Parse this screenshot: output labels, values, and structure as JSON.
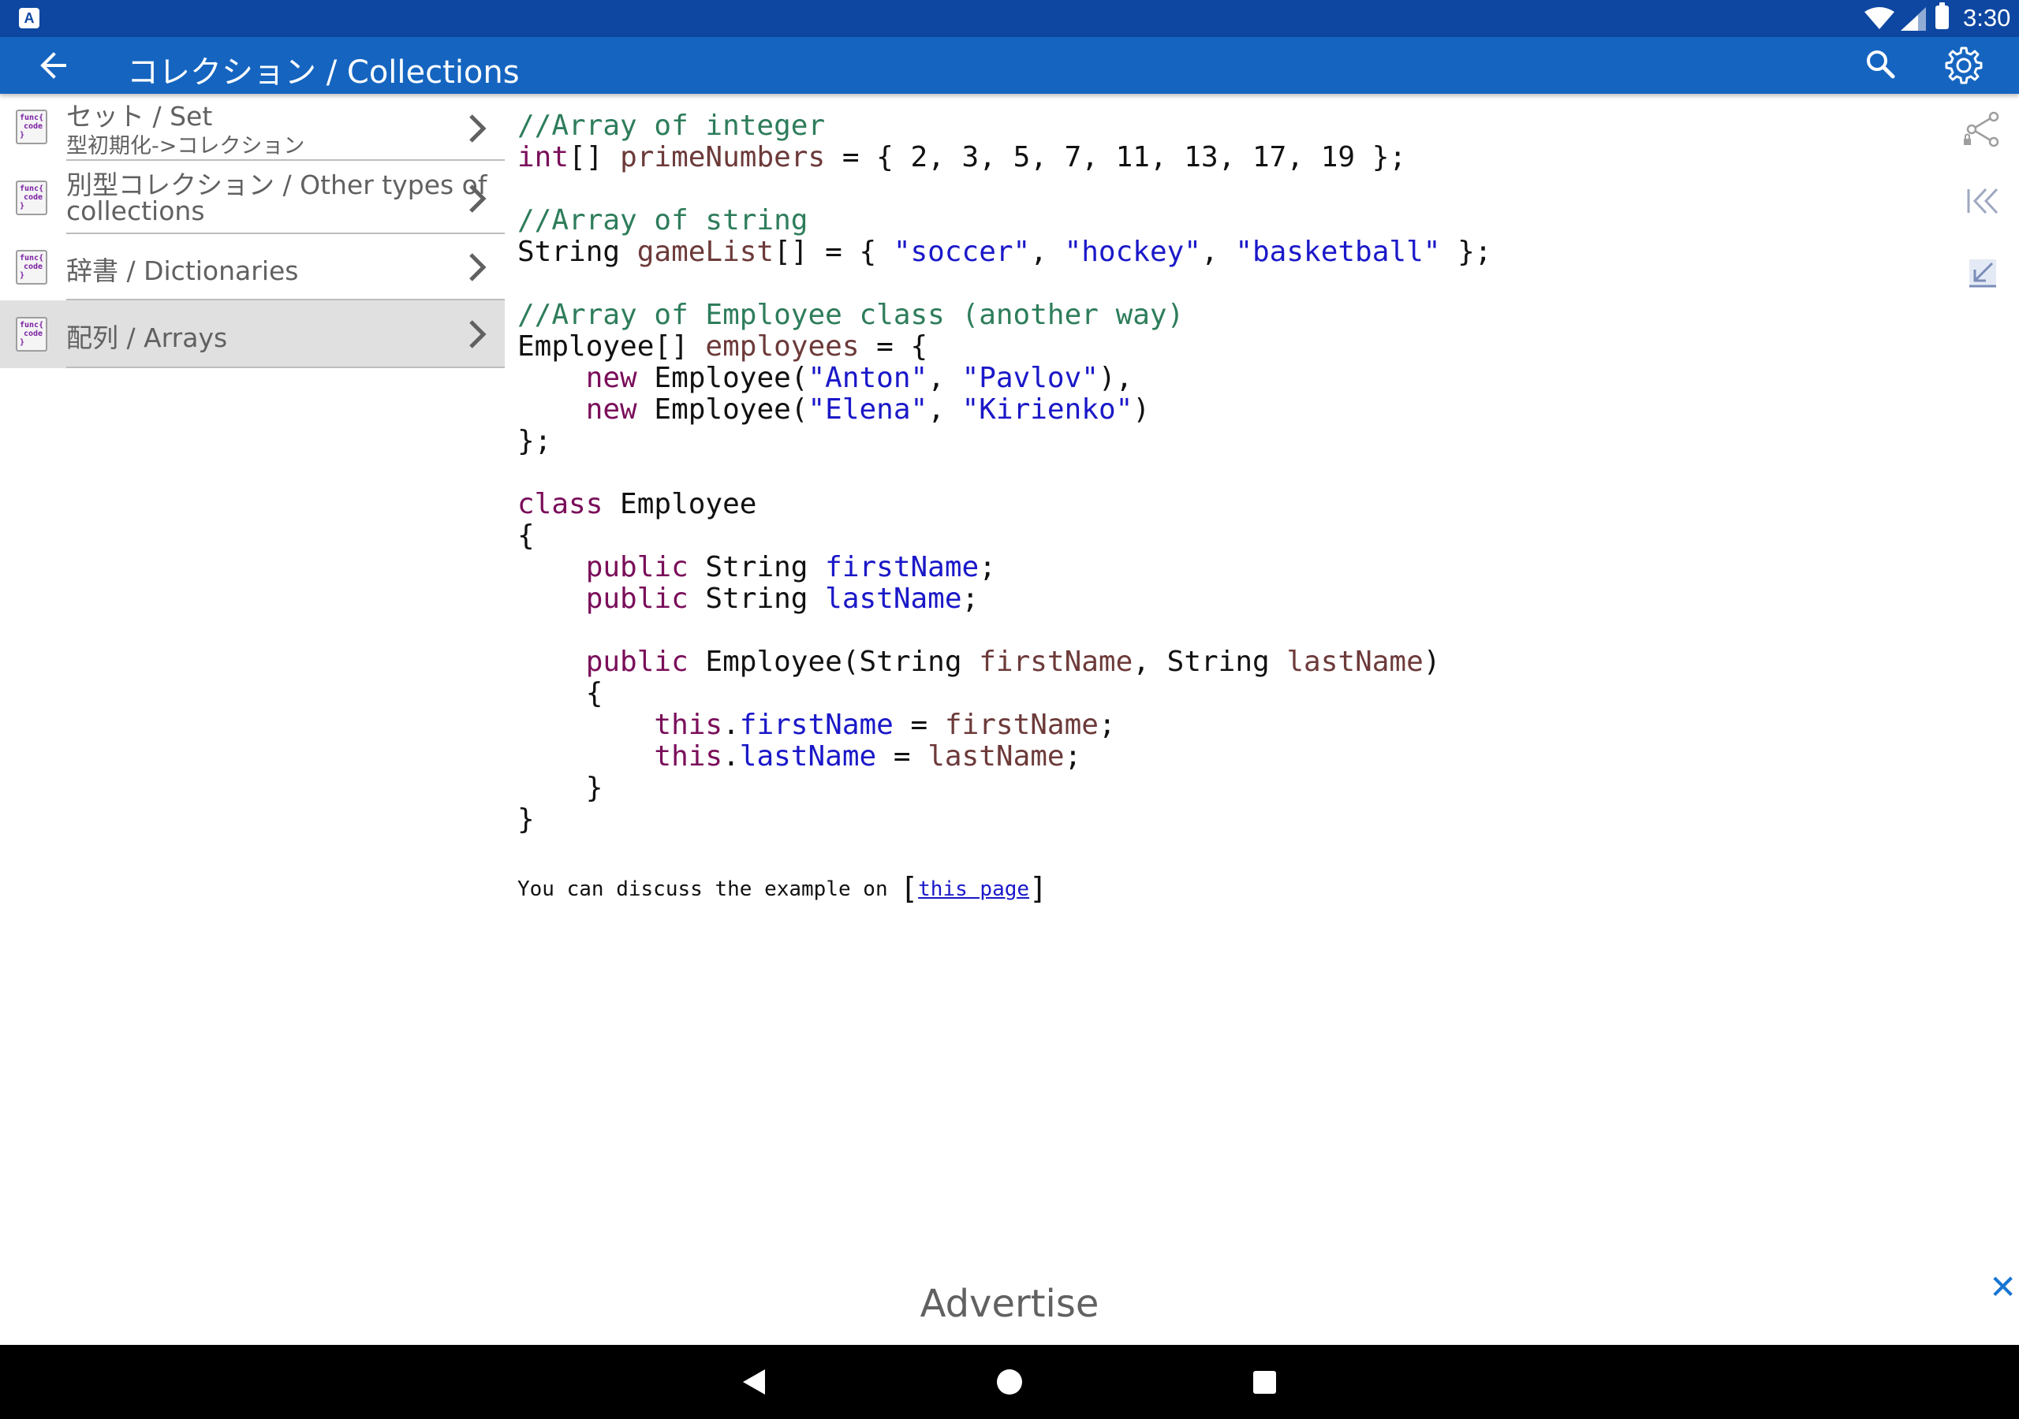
{
  "status_bar": {
    "time": "3:30",
    "notification_letter": "A"
  },
  "app_bar": {
    "title": "コレクション / Collections"
  },
  "sidebar": {
    "items": [
      {
        "label": "セット / Set",
        "sublabel": "型初期化->コレクション",
        "selected": false
      },
      {
        "label": "別型コレクション / Other types of",
        "sublabel": "collections",
        "selected": false
      },
      {
        "label": "辞書 / Dictionaries",
        "selected": false
      },
      {
        "label": "配列 / Arrays",
        "selected": true
      }
    ],
    "icon_text": [
      "func{",
      "code",
      "}"
    ]
  },
  "code_lines": [
    [
      [
        "comment",
        "//Array of integer"
      ]
    ],
    [
      [
        "keyword",
        "int"
      ],
      [
        "plain",
        "[] "
      ],
      [
        "var",
        "primeNumbers"
      ],
      [
        "plain",
        " = { 2, 3, 5, 7, 11, 13, 17, 19 };"
      ]
    ],
    [],
    [
      [
        "comment",
        "//Array of string"
      ]
    ],
    [
      [
        "plain",
        "String "
      ],
      [
        "var",
        "gameList"
      ],
      [
        "plain",
        "[] = { "
      ],
      [
        "string",
        "\"soccer\""
      ],
      [
        "plain",
        ", "
      ],
      [
        "string",
        "\"hockey\""
      ],
      [
        "plain",
        ", "
      ],
      [
        "string",
        "\"basketball\""
      ],
      [
        "plain",
        " };"
      ]
    ],
    [],
    [
      [
        "comment",
        "//Array of Employee class (another way)"
      ]
    ],
    [
      [
        "plain",
        "Employee[] "
      ],
      [
        "var",
        "employees"
      ],
      [
        "plain",
        " = {"
      ]
    ],
    [
      [
        "plain",
        "    "
      ],
      [
        "keyword",
        "new"
      ],
      [
        "plain",
        " Employee("
      ],
      [
        "string",
        "\"Anton\""
      ],
      [
        "plain",
        ", "
      ],
      [
        "string",
        "\"Pavlov\""
      ],
      [
        "plain",
        "),"
      ]
    ],
    [
      [
        "plain",
        "    "
      ],
      [
        "keyword",
        "new"
      ],
      [
        "plain",
        " Employee("
      ],
      [
        "string",
        "\"Elena\""
      ],
      [
        "plain",
        ", "
      ],
      [
        "string",
        "\"Kirienko\""
      ],
      [
        "plain",
        ")"
      ]
    ],
    [
      [
        "plain",
        "};"
      ]
    ],
    [],
    [
      [
        "keyword",
        "class"
      ],
      [
        "plain",
        " Employee"
      ]
    ],
    [
      [
        "plain",
        "{"
      ]
    ],
    [
      [
        "plain",
        "    "
      ],
      [
        "keyword",
        "public"
      ],
      [
        "plain",
        " String "
      ],
      [
        "field",
        "firstName"
      ],
      [
        "plain",
        ";"
      ]
    ],
    [
      [
        "plain",
        "    "
      ],
      [
        "keyword",
        "public"
      ],
      [
        "plain",
        " String "
      ],
      [
        "field",
        "lastName"
      ],
      [
        "plain",
        ";"
      ]
    ],
    [],
    [
      [
        "plain",
        "    "
      ],
      [
        "keyword",
        "public"
      ],
      [
        "plain",
        " Employee(String "
      ],
      [
        "var",
        "firstName"
      ],
      [
        "plain",
        ", String "
      ],
      [
        "var",
        "lastName"
      ],
      [
        "plain",
        ")"
      ]
    ],
    [
      [
        "plain",
        "    {"
      ]
    ],
    [
      [
        "plain",
        "        "
      ],
      [
        "keyword",
        "this"
      ],
      [
        "plain",
        "."
      ],
      [
        "field",
        "firstName"
      ],
      [
        "plain",
        " = "
      ],
      [
        "var",
        "firstName"
      ],
      [
        "plain",
        ";"
      ]
    ],
    [
      [
        "plain",
        "        "
      ],
      [
        "keyword",
        "this"
      ],
      [
        "plain",
        "."
      ],
      [
        "field",
        "lastName"
      ],
      [
        "plain",
        " = "
      ],
      [
        "var",
        "lastName"
      ],
      [
        "plain",
        ";"
      ]
    ],
    [
      [
        "plain",
        "    }"
      ]
    ],
    [
      [
        "plain",
        "}"
      ]
    ]
  ],
  "discussion": {
    "prefix": "You can discuss the example on ",
    "link_text": "this page"
  },
  "advertise": {
    "label": "Advertise",
    "close": "✕"
  },
  "colors": {
    "status_bar": "#0d47a1",
    "app_bar": "#1565c0",
    "selected_item": "#e0e0e0",
    "comment": "#2e7d5b",
    "keyword": "#7a0e5a",
    "string": "#1a18c8",
    "variable": "#6d3a3a"
  }
}
